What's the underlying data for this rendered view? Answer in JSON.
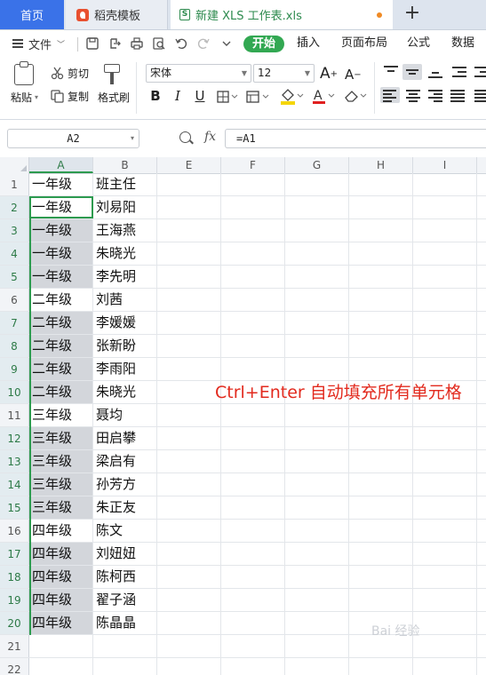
{
  "tabs": {
    "home": "首页",
    "templates": "稻壳模板",
    "document": "新建 XLS 工作表.xls",
    "new_tab": "+"
  },
  "menu": {
    "file": "文件",
    "ribbon_tabs": [
      "开始",
      "插入",
      "页面布局",
      "公式",
      "数据"
    ],
    "active_tab_color": "#32a852"
  },
  "ribbon": {
    "paste": "粘贴",
    "cut": "剪切",
    "copy": "复制",
    "format_painter": "格式刷",
    "font_name": "宋体",
    "font_size": "12",
    "bold": "B",
    "italic": "I",
    "underline": "U"
  },
  "formula_bar": {
    "name_box": "A2",
    "fx": "fx",
    "formula": "=A1"
  },
  "grid": {
    "columns": [
      "A",
      "B",
      "E",
      "F",
      "G",
      "H",
      "I"
    ],
    "rows": [
      {
        "num": "1",
        "a": "一年级",
        "b": "班主任"
      },
      {
        "num": "2",
        "a": "一年级",
        "b": "刘易阳"
      },
      {
        "num": "3",
        "a": "一年级",
        "b": "王海燕"
      },
      {
        "num": "4",
        "a": "一年级",
        "b": "朱晓光"
      },
      {
        "num": "5",
        "a": "一年级",
        "b": "李先明"
      },
      {
        "num": "6",
        "a": "二年级",
        "b": "刘茜"
      },
      {
        "num": "7",
        "a": "二年级",
        "b": "李媛媛"
      },
      {
        "num": "8",
        "a": "二年级",
        "b": "张新盼"
      },
      {
        "num": "9",
        "a": "二年级",
        "b": "李雨阳"
      },
      {
        "num": "10",
        "a": "二年级",
        "b": "朱晓光"
      },
      {
        "num": "11",
        "a": "三年级",
        "b": "聂均"
      },
      {
        "num": "12",
        "a": "三年级",
        "b": "田启攀"
      },
      {
        "num": "13",
        "a": "三年级",
        "b": "梁启有"
      },
      {
        "num": "14",
        "a": "三年级",
        "b": "孙芳方"
      },
      {
        "num": "15",
        "a": "三年级",
        "b": "朱正友"
      },
      {
        "num": "16",
        "a": "四年级",
        "b": "陈文"
      },
      {
        "num": "17",
        "a": "四年级",
        "b": "刘妞妞"
      },
      {
        "num": "18",
        "a": "四年级",
        "b": "陈柯西"
      },
      {
        "num": "19",
        "a": "四年级",
        "b": "翟子涵"
      },
      {
        "num": "20",
        "a": "四年级",
        "b": "陈晶晶"
      },
      {
        "num": "21",
        "a": "",
        "b": ""
      },
      {
        "num": "22",
        "a": "",
        "b": ""
      }
    ],
    "selected_rows": [
      "2",
      "3",
      "4",
      "5",
      "7",
      "8",
      "9",
      "10",
      "12",
      "13",
      "14",
      "15",
      "17",
      "18",
      "19",
      "20"
    ],
    "active_row": "2"
  },
  "annotation": "Ctrl+Enter 自动填充所有单元格",
  "watermark": "Bai 经验"
}
